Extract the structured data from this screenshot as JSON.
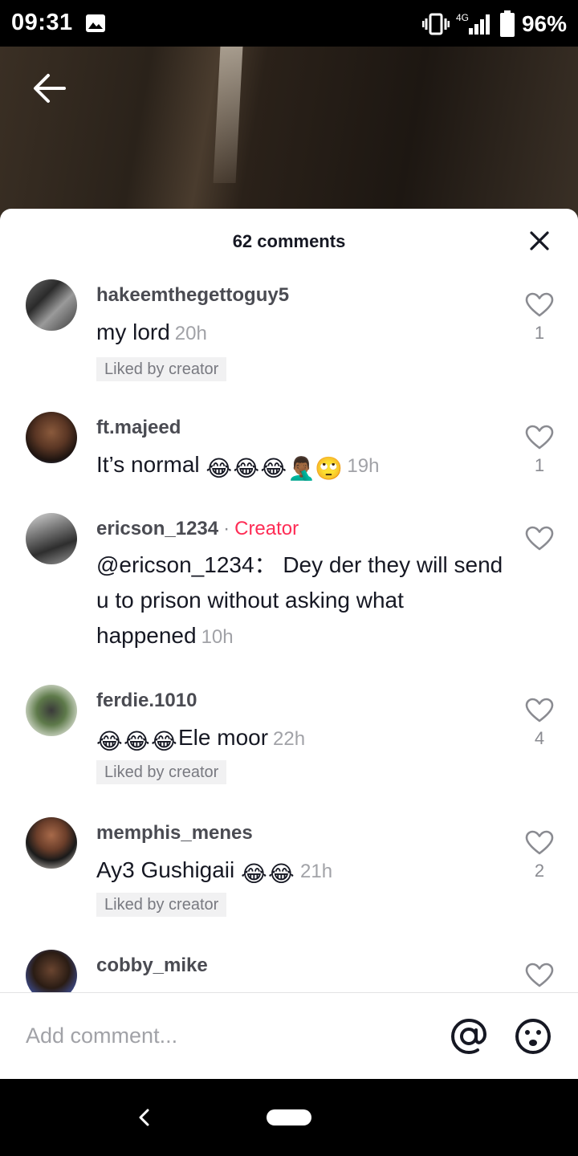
{
  "status_bar": {
    "time": "09:31",
    "network": "4G",
    "battery": "96%",
    "icons": [
      "gallery-icon",
      "vibrate-icon",
      "signal-icon",
      "battery-icon"
    ]
  },
  "header": {
    "back_icon": "back-arrow-icon"
  },
  "sheet": {
    "title": "62 comments",
    "close_icon": "close-icon"
  },
  "comments": [
    {
      "username": "hakeemthegettoguy5",
      "text": "my lord",
      "emojis": [],
      "time": "20h",
      "liked_by_creator": "Liked by creator",
      "likes": "1"
    },
    {
      "username": "ft.majeed",
      "text": "It’s normal",
      "emojis": [
        "😂",
        "😂",
        "😂",
        "🤦🏾‍♂️",
        "🙄"
      ],
      "time": "19h",
      "liked_by_creator": "",
      "likes": "1"
    },
    {
      "username": "ericson_1234",
      "creator_tag": "Creator",
      "text": "@ericson_1234： Dey der they will send u to prison without asking what happened",
      "emojis": [],
      "time": "10h",
      "liked_by_creator": "",
      "likes": ""
    },
    {
      "username": "ferdie.1010",
      "text": "Ele moor",
      "emojis_before": [
        "😂",
        "😂",
        "😂"
      ],
      "time": "22h",
      "liked_by_creator": "Liked by creator",
      "likes": "4"
    },
    {
      "username": "memphis_menes",
      "text": "Ay3 Gushigaii",
      "emojis": [
        "😂",
        "😂"
      ],
      "time": "21h",
      "liked_by_creator": "Liked by creator",
      "likes": "2"
    },
    {
      "username": "cobby_mike",
      "text": "",
      "emojis": [],
      "time": "",
      "liked_by_creator": "",
      "likes": ""
    }
  ],
  "input": {
    "placeholder": "Add comment...",
    "mention_icon": "at-icon",
    "emoji_icon": "emoji-icon"
  },
  "nav_bar": {
    "icons": [
      "nav-back-icon",
      "home-pill-icon"
    ]
  },
  "colors": {
    "creator_accent": "#fe2c55",
    "text_primary": "#161823",
    "text_secondary": "#8a8b91"
  }
}
